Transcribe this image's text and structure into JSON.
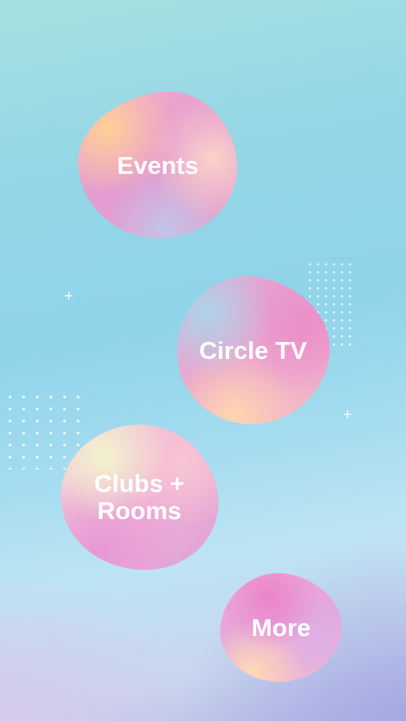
{
  "menu": {
    "items": [
      {
        "label": "Events"
      },
      {
        "label": "Circle TV"
      },
      {
        "label": "Clubs +\nRooms"
      },
      {
        "label": "More"
      }
    ]
  },
  "decorations": {
    "plus_glyph": "+",
    "icons": [
      "plus-icon",
      "dot-grid"
    ]
  },
  "colors": {
    "background_top": "#a6dfe0",
    "background_mid": "#90d4ea",
    "background_bottom": "#b8bde6",
    "blob_pink": "#e9a3d0",
    "label": "#ffffff"
  }
}
